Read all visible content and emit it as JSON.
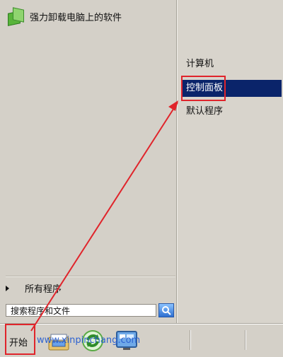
{
  "start_menu": {
    "pinned_program": {
      "label": "强力卸载电脑上的软件",
      "icon": "install-box-icon"
    },
    "all_programs_label": "所有程序",
    "search": {
      "value": "搜索程序和文件",
      "icon": "search-icon"
    },
    "right_items": [
      {
        "label": "计算机",
        "selected": false
      },
      {
        "label": "控制面板",
        "selected": true
      },
      {
        "label": "默认程序",
        "selected": false
      }
    ]
  },
  "taskbar": {
    "start_label": "开始",
    "watermark": "www.xinpinchang.com",
    "icons": [
      "file-manager-icon",
      "refresh-icon",
      "monitor-icon"
    ]
  },
  "colors": {
    "selection": "#0a246a",
    "annotation_red": "#e0242b",
    "background": "#d4d0c8"
  }
}
